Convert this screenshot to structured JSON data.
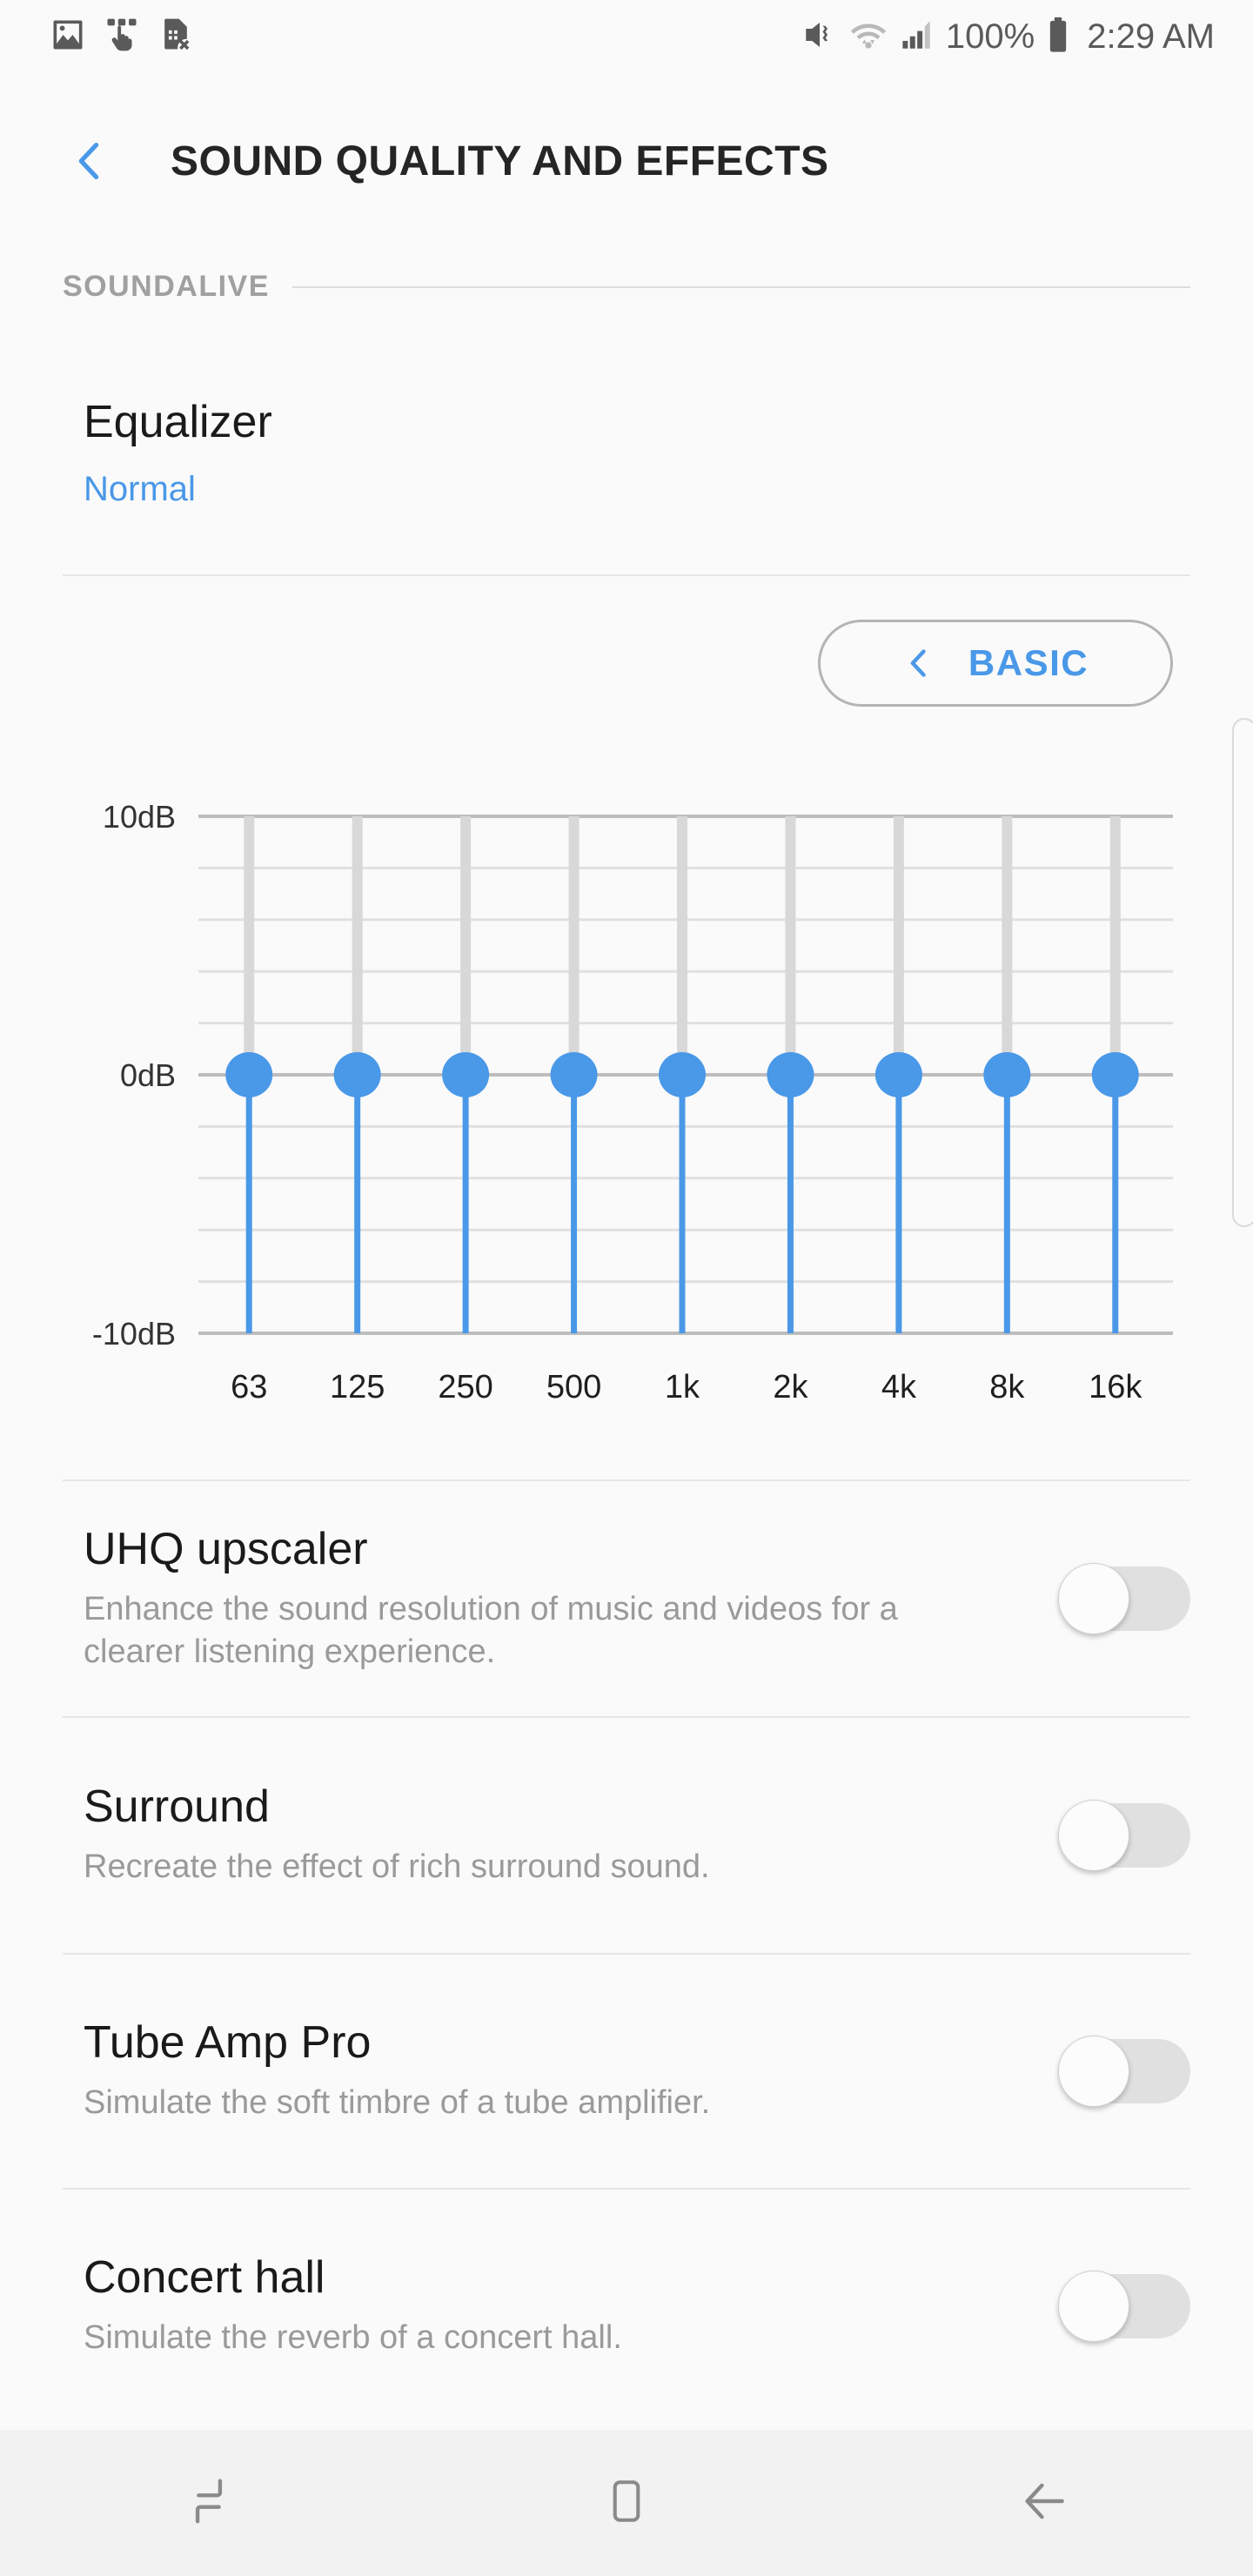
{
  "statusbar": {
    "left_icons": [
      "image-icon",
      "multi-touch-icon",
      "sim-card-off-icon"
    ],
    "right_icons": [
      "mute-vibrate-icon",
      "wifi-icon",
      "signal-bars-icon",
      "battery-icon"
    ],
    "battery_percent": "100%",
    "time": "2:29 AM"
  },
  "header": {
    "back_icon": "chevron-left-icon",
    "title": "SOUND QUALITY AND EFFECTS"
  },
  "section": {
    "label": "SOUNDALIVE"
  },
  "equalizer": {
    "title": "Equalizer",
    "preset": "Normal",
    "mode_button": {
      "label": "BASIC",
      "icon": "chevron-left-icon"
    }
  },
  "chart_data": {
    "type": "bar",
    "title": "Equalizer",
    "categories": [
      "63",
      "125",
      "250",
      "500",
      "1k",
      "2k",
      "4k",
      "8k",
      "16k"
    ],
    "values": [
      0,
      0,
      0,
      0,
      0,
      0,
      0,
      0,
      0
    ],
    "xlabel": "",
    "ylabel": "dB",
    "ylim": [
      -10,
      10
    ],
    "y_tick_labels": [
      "10dB",
      "0dB",
      "-10dB"
    ],
    "y_tick_values": [
      10,
      0,
      -10
    ],
    "gridline_values": [
      10,
      8,
      6,
      4,
      2,
      0,
      -2,
      -4,
      -6,
      -8,
      -10
    ],
    "grid": true,
    "legend": "none",
    "accent_color": "#4a98e8",
    "track_color": "#d8d8d8",
    "grid_color": "#e0e0e0"
  },
  "settings": [
    {
      "title": "UHQ upscaler",
      "description": "Enhance the sound resolution of music and videos for a clearer listening experience.",
      "toggle_state": "off"
    },
    {
      "title": "Surround",
      "description": "Recreate the effect of rich surround sound.",
      "toggle_state": "off"
    },
    {
      "title": "Tube Amp Pro",
      "description": "Simulate the soft timbre of a tube amplifier.",
      "toggle_state": "off"
    },
    {
      "title": "Concert hall",
      "description": "Simulate the reverb of a concert hall.",
      "toggle_state": "off"
    }
  ],
  "navbar": {
    "recents_icon": "recents-icon",
    "home_icon": "home-icon",
    "back_icon": "back-arrow-icon"
  }
}
